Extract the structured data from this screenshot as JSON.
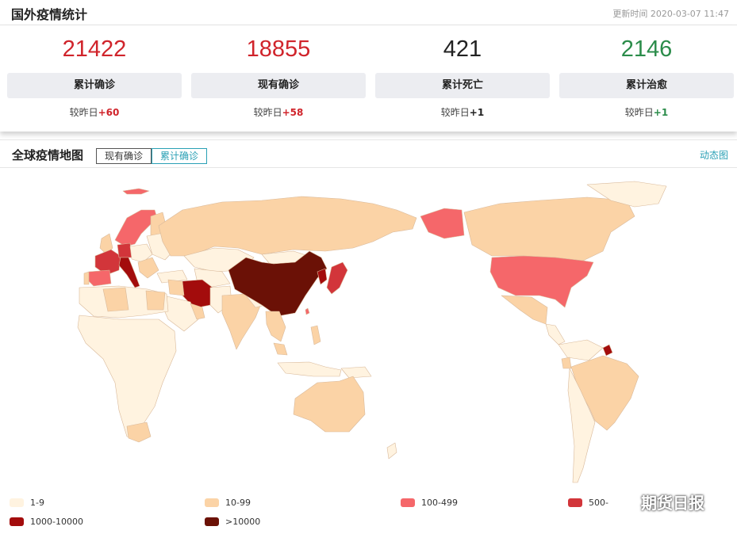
{
  "header": {
    "title": "国外疫情统计",
    "updated": "更新时间 2020-03-07 11:47"
  },
  "stats": [
    {
      "number": "21422",
      "label": "累计确诊",
      "delta_prefix": "较昨日",
      "delta": "+60",
      "color": "#d0242b"
    },
    {
      "number": "18855",
      "label": "现有确诊",
      "delta_prefix": "较昨日",
      "delta": "+58",
      "color": "#d0242b"
    },
    {
      "number": "421",
      "label": "累计死亡",
      "delta_prefix": "较昨日",
      "delta": "+1",
      "color": "#222222"
    },
    {
      "number": "2146",
      "label": "累计治愈",
      "delta_prefix": "较昨日",
      "delta": "+1",
      "color": "#2b8c4a"
    }
  ],
  "map_section": {
    "title": "全球疫情地图",
    "tabs": [
      {
        "label": "现有确诊",
        "active": false
      },
      {
        "label": "累计确诊",
        "active": true
      }
    ],
    "dynamic_link": "动态图"
  },
  "legend": [
    {
      "label": "1-9",
      "color": "#fff3e0"
    },
    {
      "label": "10-99",
      "color": "#fbd3a6"
    },
    {
      "label": "100-499",
      "color": "#f5676a"
    },
    {
      "label": "500-",
      "color": "#d2353a"
    },
    {
      "label": "1000-10000",
      "color": "#a30c0c"
    },
    {
      "label": ">10000",
      "color": "#6b1106"
    }
  ],
  "watermark": "期货日报"
}
